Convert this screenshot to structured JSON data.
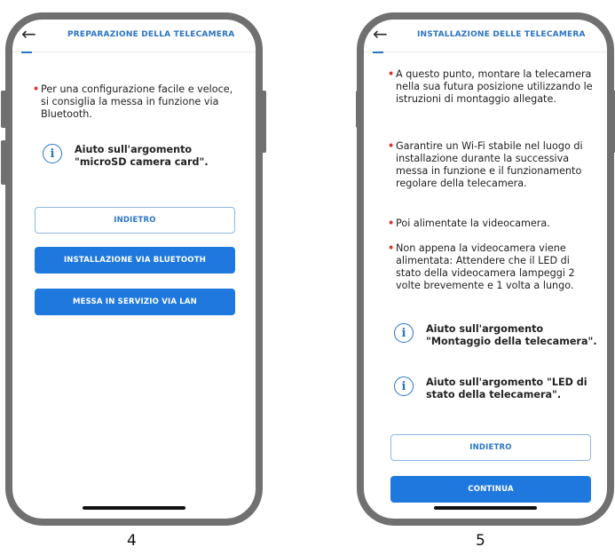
{
  "screen4": {
    "title": "PREPARAZIONE DELLA TELECAMERA",
    "back_icon": "←",
    "bullet": "Per una configurazione facile e veloce, si consiglia la messa in funzione via Bluetooth.",
    "help": "Aiuto sull'argomento \"microSD camera card\".",
    "back_button": "INDIETRO",
    "bluetooth_button": "INSTALLAZIONE VIA BLUETOOTH",
    "lan_button": "MESSA IN SERVIZIO VIA LAN",
    "caption": "4"
  },
  "screen5": {
    "title": "INSTALLAZIONE DELLE TELECAMERA",
    "back_icon": "←",
    "bullets": [
      "A questo punto, montare la telecamera nella sua futura posizione utilizzando le istruzioni di montaggio allegate.",
      "Garantire un Wi-Fi stabile nel luogo di installazione durante la successiva messa in funzione e il funzionamento regolare della telecamera.",
      "Poi alimentate la videocamera.",
      "Non appena la videocamera viene alimentata: Attendere che il LED di stato della videocamera lampeggi 2 volte brevemente e 1 volta a lungo."
    ],
    "help1": "Aiuto sull'argomento \"Montaggio della telecamera\".",
    "help2": "Aiuto sull'argomento \"LED di stato della telecamera\".",
    "back_button": "INDIETRO",
    "continue_button": "CONTINUA",
    "caption": "5"
  },
  "icons": {
    "back": "arrow-left-icon",
    "info": "info-circle-icon"
  },
  "colors": {
    "accent": "#2a74c4",
    "button": "#1f78dd",
    "bullet": "#e0312f",
    "frame": "#707070"
  }
}
